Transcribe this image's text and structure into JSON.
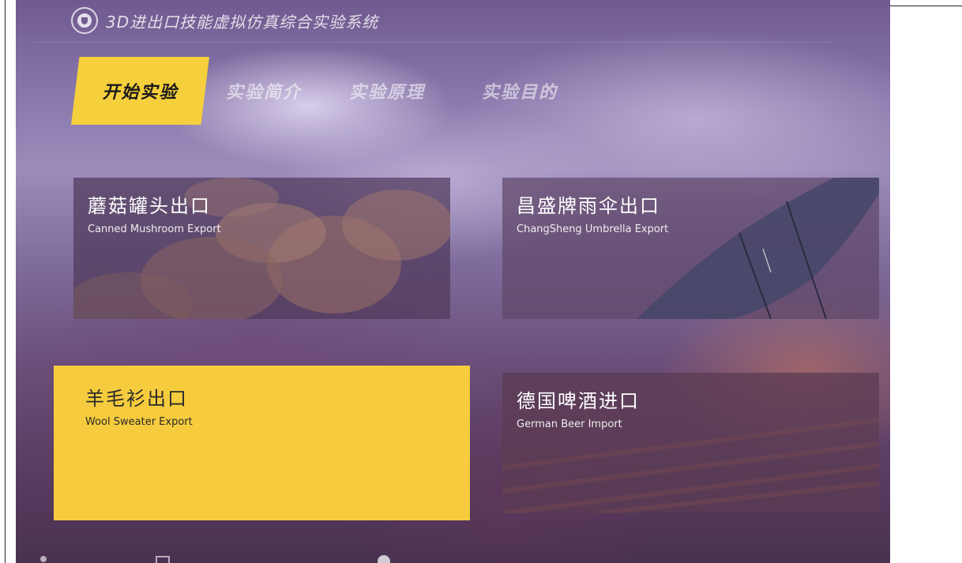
{
  "app": {
    "title": "3D进出口技能虚拟仿真综合实验系统",
    "logo_icon": "shield-logo-icon"
  },
  "tabs": [
    {
      "label": "开始实验",
      "active": true
    },
    {
      "label": "实验简介",
      "active": false
    },
    {
      "label": "实验原理",
      "active": false
    },
    {
      "label": "实验目的",
      "active": false
    }
  ],
  "cards": [
    {
      "title": "蘑菇罐头出口",
      "subtitle": "Canned Mushroom Export",
      "selected": false,
      "image": "mushroom-image"
    },
    {
      "title": "昌盛牌雨伞出口",
      "subtitle": "ChangSheng Umbrella Export",
      "selected": false,
      "image": "umbrella-image"
    },
    {
      "title": "羊毛衫出口",
      "subtitle": "Wool Sweater Export",
      "selected": true,
      "image": ""
    },
    {
      "title": "德国啤酒进口",
      "subtitle": "German Beer Import",
      "selected": false,
      "image": "wood-image"
    }
  ],
  "colors": {
    "accent": "#f5cf3c",
    "selected_card": "#f6cc3e",
    "card_bg": "#46304f"
  },
  "bottom_icons": [
    "user-icon",
    "document-icon",
    "circle-icon"
  ]
}
